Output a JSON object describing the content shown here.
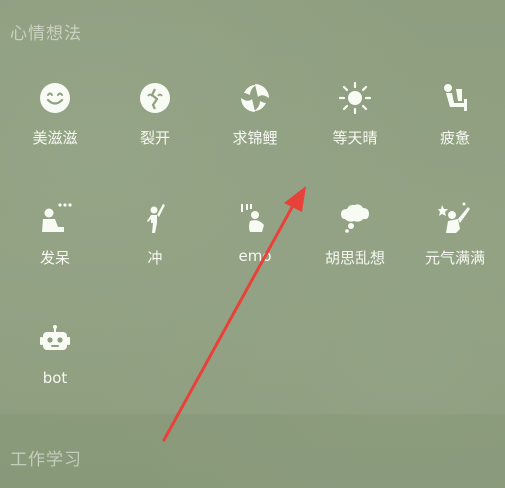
{
  "sections": {
    "mood": "心情想法",
    "work": "工作学习"
  },
  "items": [
    {
      "label": "美滋滋",
      "icon": "smile-face-icon"
    },
    {
      "label": "裂开",
      "icon": "cracked-heart-icon"
    },
    {
      "label": "求锦鲤",
      "icon": "koi-fish-icon"
    },
    {
      "label": "等天晴",
      "icon": "sun-icon"
    },
    {
      "label": "疲惫",
      "icon": "tired-person-icon"
    },
    {
      "label": "发呆",
      "icon": "daydream-person-icon"
    },
    {
      "label": "冲",
      "icon": "cheering-person-icon"
    },
    {
      "label": "emo",
      "icon": "sad-crouching-person-icon"
    },
    {
      "label": "胡思乱想",
      "icon": "thought-bubble-icon"
    },
    {
      "label": "元气满满",
      "icon": "energetic-person-icon"
    },
    {
      "label": "bot",
      "icon": "robot-icon"
    }
  ],
  "colors": {
    "background": "#8f9f80",
    "icon": "#f8faf4",
    "annotation_arrow": "#e8413a"
  }
}
